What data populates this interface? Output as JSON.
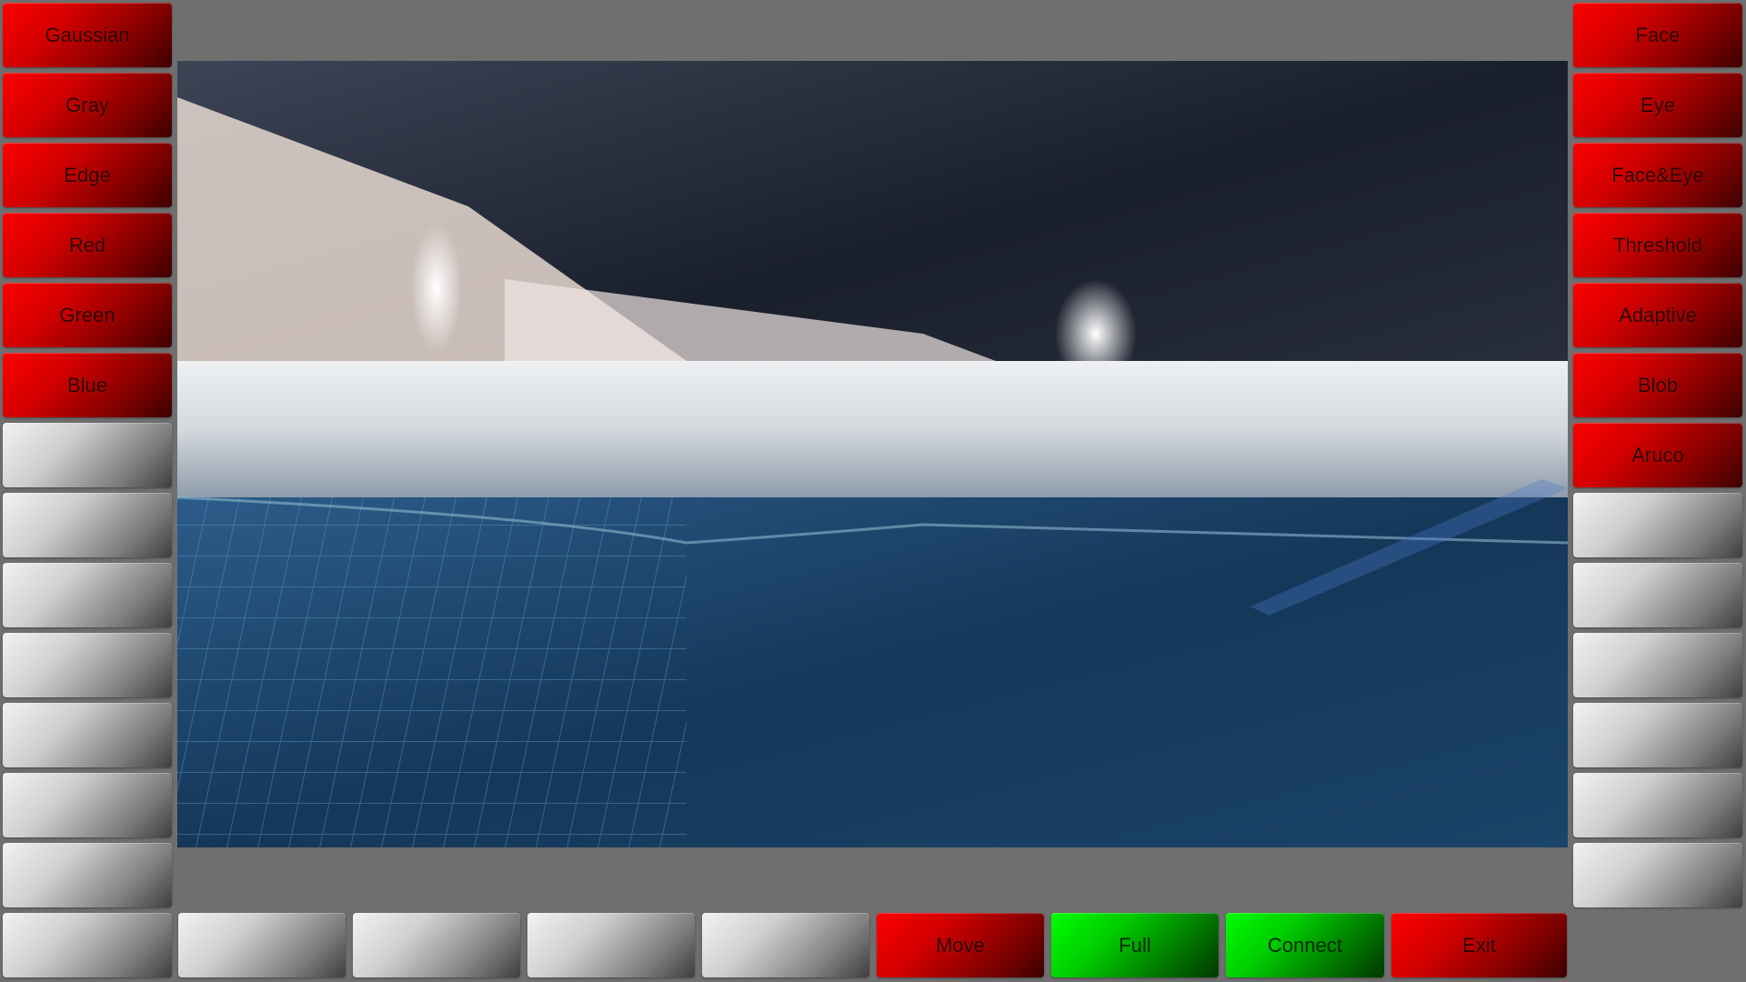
{
  "left_column": [
    {
      "label": "Gaussian",
      "style": "red"
    },
    {
      "label": "Gray",
      "style": "red"
    },
    {
      "label": "Edge",
      "style": "red"
    },
    {
      "label": "Red",
      "style": "red"
    },
    {
      "label": "Green",
      "style": "red"
    },
    {
      "label": "Blue",
      "style": "red"
    },
    {
      "label": "",
      "style": "gray"
    },
    {
      "label": "",
      "style": "gray"
    },
    {
      "label": "",
      "style": "gray"
    },
    {
      "label": "",
      "style": "gray"
    },
    {
      "label": "",
      "style": "gray"
    },
    {
      "label": "",
      "style": "gray"
    },
    {
      "label": "",
      "style": "gray"
    },
    {
      "label": "",
      "style": "gray"
    }
  ],
  "right_column": [
    {
      "label": "Face",
      "style": "red"
    },
    {
      "label": "Eye",
      "style": "red"
    },
    {
      "label": "Face&Eye",
      "style": "red"
    },
    {
      "label": "Threshold",
      "style": "red"
    },
    {
      "label": "Adaptive",
      "style": "red"
    },
    {
      "label": "Blob",
      "style": "red"
    },
    {
      "label": "Aruco",
      "style": "red"
    },
    {
      "label": "",
      "style": "gray"
    },
    {
      "label": "",
      "style": "gray"
    },
    {
      "label": "",
      "style": "gray"
    },
    {
      "label": "",
      "style": "gray"
    },
    {
      "label": "",
      "style": "gray"
    },
    {
      "label": "",
      "style": "gray"
    }
  ],
  "bottom_row": [
    {
      "label": "",
      "style": "gray"
    },
    {
      "label": "",
      "style": "gray"
    },
    {
      "label": "",
      "style": "gray"
    },
    {
      "label": "",
      "style": "gray"
    },
    {
      "label": "Move",
      "style": "red"
    },
    {
      "label": "Full",
      "style": "green"
    },
    {
      "label": "Connect",
      "style": "green"
    },
    {
      "label": "Exit",
      "style": "red"
    }
  ],
  "colors": {
    "background": "#6f6f6f",
    "red_button": "#ff0000",
    "green_button": "#00ff00",
    "gray_button": "#cfcfcf"
  },
  "camera_view": {
    "description_icon": "camera-feed"
  }
}
